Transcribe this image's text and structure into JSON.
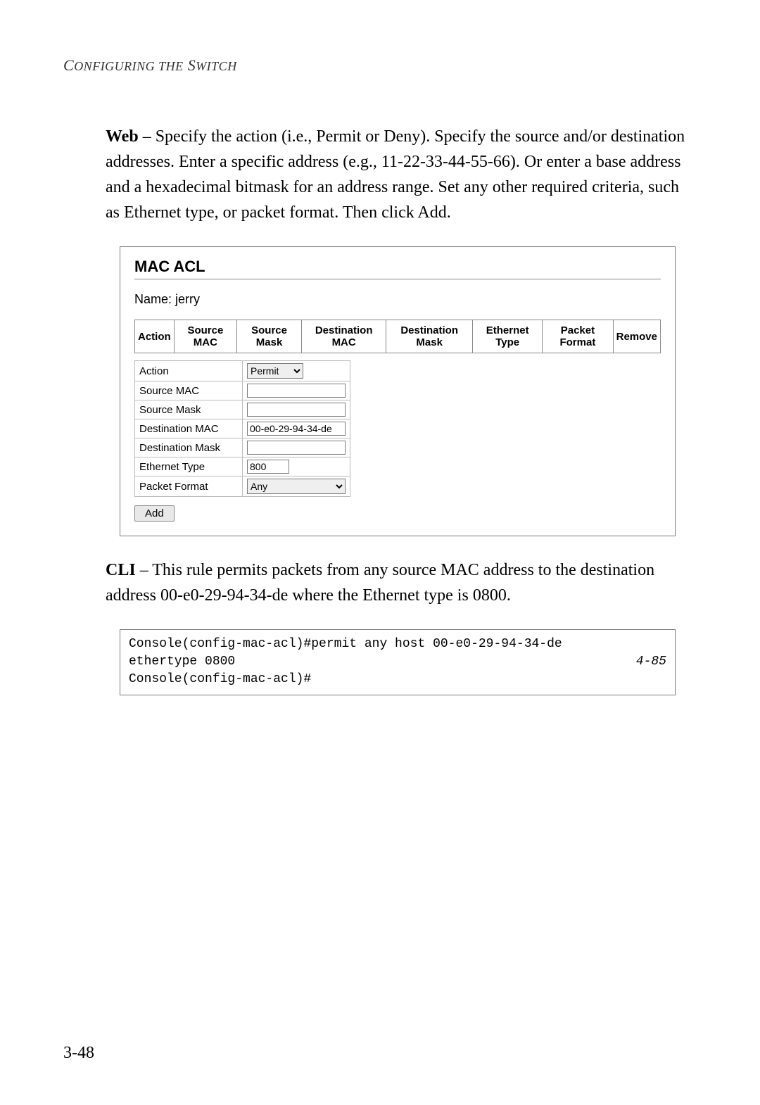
{
  "running_head": "Configuring the Switch",
  "para1_lead": "Web",
  "para1_rest": " – Specify the action (i.e., Permit or Deny). Specify the source and/or destination addresses. Enter a specific address (e.g., 11-22-33-44-55-66). Or enter a base address and a hexadecimal bitmask for an address range. Set any other required criteria, such as Ethernet type, or packet format. Then click Add.",
  "screenshot": {
    "title": "MAC ACL",
    "name_label": "Name: jerry",
    "headers": [
      "Action",
      "Source MAC",
      "Source Mask",
      "Destination MAC",
      "Destination Mask",
      "Ethernet Type",
      "Packet Format",
      "Remove"
    ],
    "form": {
      "action_label": "Action",
      "action_value": "Permit",
      "src_mac_label": "Source MAC",
      "src_mac_value": "",
      "src_mask_label": "Source Mask",
      "src_mask_value": "",
      "dst_mac_label": "Destination MAC",
      "dst_mac_value": "00-e0-29-94-34-de",
      "dst_mask_label": "Destination Mask",
      "dst_mask_value": "",
      "eth_type_label": "Ethernet Type",
      "eth_type_value": "800",
      "pkt_fmt_label": "Packet Format",
      "pkt_fmt_value": "Any"
    },
    "add_button": "Add"
  },
  "para2_lead": "CLI",
  "para2_rest": " – This rule permits packets from any source MAC address to the destination address 00-e0-29-94-34-de where the Ethernet type is 0800.",
  "cli": {
    "line1": "Console(config-mac-acl)#permit any host 00-e0-29-94-34-de ethertype 0800",
    "ref": "4-85",
    "line2": "Console(config-mac-acl)#"
  },
  "page_number": "3-48"
}
